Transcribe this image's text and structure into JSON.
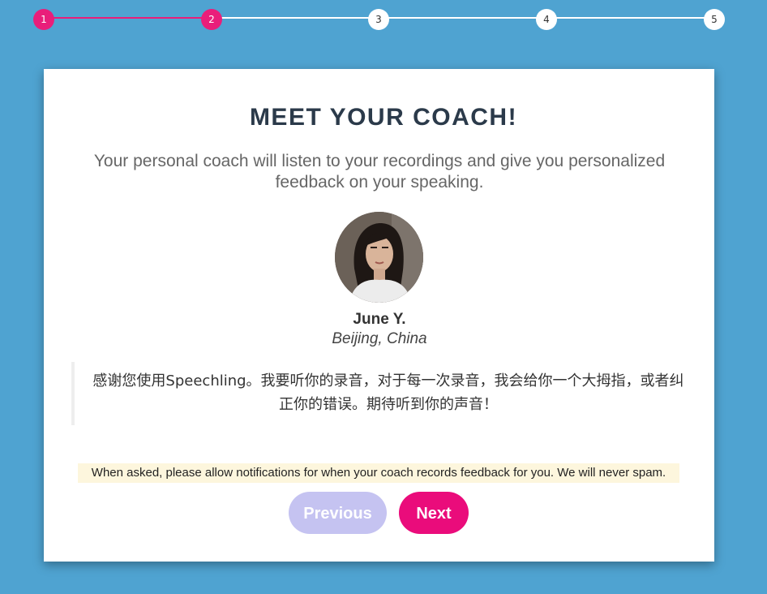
{
  "stepper": {
    "steps": [
      "1",
      "2",
      "3",
      "4",
      "5"
    ],
    "current_step": 2
  },
  "colors": {
    "background": "#4fa3d1",
    "accent": "#e91e7a",
    "next_button": "#ea0c7b",
    "previous_button_disabled": "#c5c3f1",
    "notice_background": "#fdf6dd"
  },
  "card": {
    "title": "MEET YOUR COACH!",
    "subtitle": "Your personal coach will listen to your recordings and give you personalized feedback on your speaking.",
    "coach": {
      "name": "June Y.",
      "location": "Beijing, China"
    },
    "quote": "感谢您使用Speechling。我要听你的录音，对于每一次录音，我会给你一个大拇指，或者纠正你的错误。期待听到你的声音！",
    "notice": "When asked, please allow notifications for when your coach records feedback for you. We will never spam.",
    "buttons": {
      "previous": "Previous",
      "next": "Next"
    }
  }
}
